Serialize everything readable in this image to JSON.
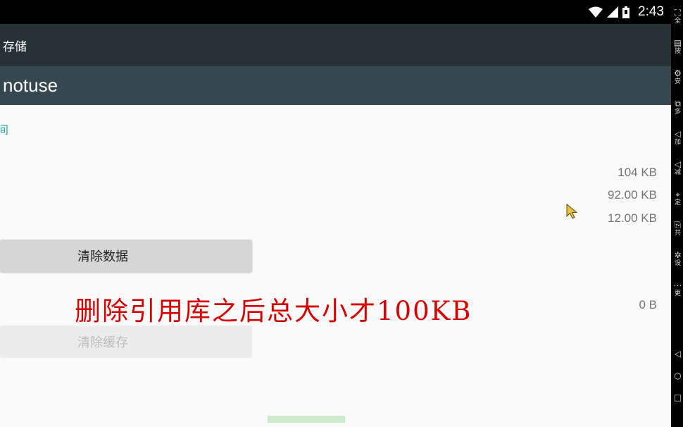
{
  "status_bar": {
    "time": "2:43"
  },
  "app_bar": {
    "title": "存储"
  },
  "app_header": {
    "app_name": "notuse"
  },
  "section": {
    "label": "间"
  },
  "storage": {
    "total": "104 KB",
    "app": "92.00 KB",
    "data": "12.00 KB",
    "cache": "0 B"
  },
  "buttons": {
    "clear_data": "清除数据",
    "clear_cache": "清除缓存"
  },
  "overlay": {
    "caption": "删除引用库之后总大小才100KB"
  },
  "sidebar": {
    "items": [
      {
        "icon": "fullscreen-icon",
        "glyph": "⛶",
        "label": "全"
      },
      {
        "icon": "keys-icon",
        "glyph": "▤",
        "label": "按"
      },
      {
        "icon": "install-icon",
        "glyph": "⚙",
        "label": "安"
      },
      {
        "icon": "multi-icon",
        "glyph": "⧉",
        "label": "多"
      },
      {
        "icon": "volume-up-icon",
        "glyph": "◁",
        "label": "加"
      },
      {
        "icon": "volume-down-icon",
        "glyph": "◁",
        "label": "减"
      },
      {
        "icon": "location-icon",
        "glyph": "⌖",
        "label": "定"
      },
      {
        "icon": "share-icon",
        "glyph": "⎘",
        "label": "共"
      },
      {
        "icon": "settings-icon",
        "glyph": "✲",
        "label": "设"
      },
      {
        "icon": "more-icon",
        "glyph": "⋯",
        "label": "更"
      }
    ],
    "nav": [
      {
        "icon": "back-icon",
        "glyph": "◁"
      },
      {
        "icon": "home-icon",
        "glyph": "○"
      },
      {
        "icon": "recents-icon",
        "glyph": "□"
      }
    ]
  }
}
